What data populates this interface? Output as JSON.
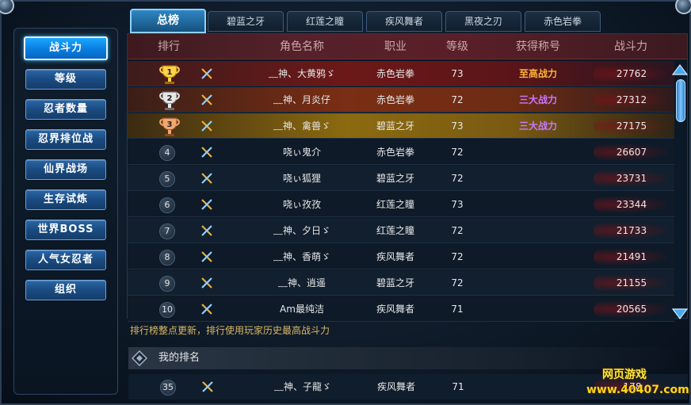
{
  "sidebar": {
    "items": [
      {
        "label": "战斗力",
        "active": true
      },
      {
        "label": "等级"
      },
      {
        "label": "忍者数量"
      },
      {
        "label": "忍界排位战"
      },
      {
        "label": "仙界战场"
      },
      {
        "label": "生存试炼"
      },
      {
        "label": "世界BOSS"
      },
      {
        "label": "人气女忍者"
      },
      {
        "label": "组织"
      }
    ]
  },
  "tabs": [
    {
      "label": "总榜",
      "active": true
    },
    {
      "label": "碧蓝之牙"
    },
    {
      "label": "红莲之瞳"
    },
    {
      "label": "疾风舞者"
    },
    {
      "label": "黑夜之刃"
    },
    {
      "label": "赤色岩拳"
    }
  ],
  "table": {
    "headers": [
      "排行",
      "角色名称",
      "职业",
      "等级",
      "获得称号",
      "战斗力"
    ],
    "rows": [
      {
        "rank": "1",
        "name": "﹏神、大黄鸦ゞ",
        "job": "赤色岩拳",
        "level": "73",
        "title": "至高战力",
        "title_color": "gold",
        "power": "27762"
      },
      {
        "rank": "2",
        "name": "﹏神、月炎仔",
        "job": "赤色岩拳",
        "level": "72",
        "title": "三大战力",
        "title_color": "purple",
        "power": "27312"
      },
      {
        "rank": "3",
        "name": "﹏神、禽兽ゞ",
        "job": "碧蓝之牙",
        "level": "73",
        "title": "三大战力",
        "title_color": "purple",
        "power": "27175"
      },
      {
        "rank": "4",
        "name": "哓ぃ鬼介",
        "job": "赤色岩拳",
        "level": "72",
        "title": "",
        "power": "26607"
      },
      {
        "rank": "5",
        "name": "哓ぃ狐狸",
        "job": "碧蓝之牙",
        "level": "72",
        "title": "",
        "power": "23731"
      },
      {
        "rank": "6",
        "name": "哓ぃ孜孜",
        "job": "红莲之瞳",
        "level": "73",
        "title": "",
        "power": "23344"
      },
      {
        "rank": "7",
        "name": "﹏神、夕日ゞ",
        "job": "红莲之瞳",
        "level": "72",
        "title": "",
        "power": "21733"
      },
      {
        "rank": "8",
        "name": "﹏神、香萌ゞ",
        "job": "疾风舞者",
        "level": "72",
        "title": "",
        "power": "21491"
      },
      {
        "rank": "9",
        "name": "﹏神、逍遥",
        "job": "碧蓝之牙",
        "level": "72",
        "title": "",
        "power": "21155"
      },
      {
        "rank": "10",
        "name": "Am最纯洁",
        "job": "疾风舞者",
        "level": "71",
        "title": "",
        "power": "20565"
      }
    ]
  },
  "note": "排行榜整点更新，排行使用玩家历史最高战斗力",
  "my_rank": {
    "label": "我的排名",
    "row": {
      "rank": "35",
      "name": "﹏神、子龍ゞ",
      "job": "疾风舞者",
      "level": "71",
      "power": "178"
    }
  },
  "watermark": {
    "line1": "网页游戏",
    "line2": "www.40407.com"
  },
  "colors": {
    "gold": "#ffb33a",
    "purple": "#c877ff",
    "accent": "#1aa8ff"
  },
  "icons": [
    "trophy-gold-icon",
    "trophy-silver-icon",
    "trophy-bronze-icon",
    "crossed-swords-icon",
    "scroll-up-arrow-icon",
    "scroll-down-arrow-icon",
    "diamond-icon"
  ]
}
